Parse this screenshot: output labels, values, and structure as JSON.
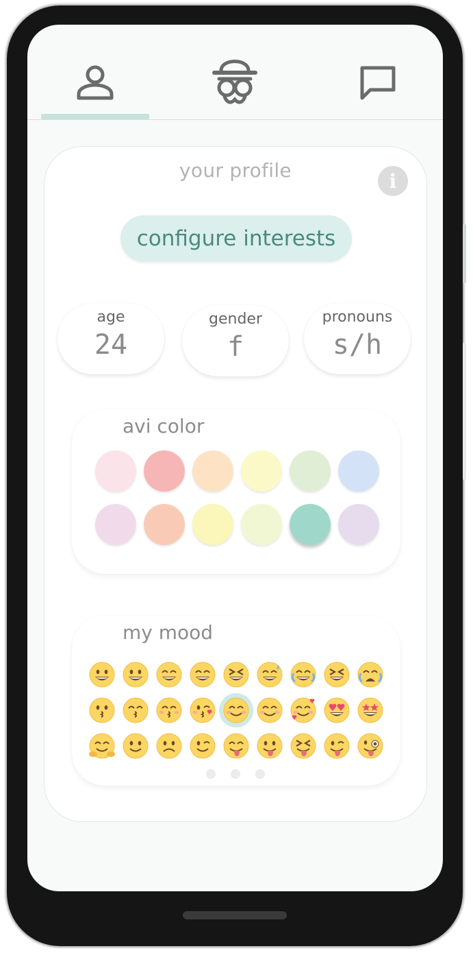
{
  "nav": {
    "tabs": [
      {
        "name": "profile",
        "icon": "person-icon",
        "active": true
      },
      {
        "name": "match",
        "icon": "hat-glasses-icon",
        "active": false
      },
      {
        "name": "chat",
        "icon": "chat-bubble-icon",
        "active": false
      }
    ]
  },
  "profile": {
    "title": "your profile",
    "info_label": "i",
    "interests_label": "configure interests",
    "stats": [
      {
        "label": "age",
        "value": "24"
      },
      {
        "label": "gender",
        "value": "f"
      },
      {
        "label": "pronouns",
        "value": "s/h"
      }
    ]
  },
  "avi": {
    "title": "avi color",
    "colors": [
      "#fbe3ea",
      "#f7b6b6",
      "#fde2c4",
      "#fcf9c8",
      "#e1eed6",
      "#d3e2f6",
      "#f1dbea",
      "#f9cbb6",
      "#fbf6b9",
      "#f2f7d3",
      "#9fd8cb",
      "#e6dced"
    ],
    "selected_index": 10
  },
  "mood": {
    "title": "my mood",
    "selected_index": 13,
    "emojis": [
      "grinning-face-icon",
      "grinning-big-eyes-icon",
      "grinning-smiling-eyes-icon",
      "beaming-face-icon",
      "squinting-laugh-icon",
      "sweat-smile-icon",
      "tears-of-joy-icon",
      "rolling-laughing-icon",
      "loudly-crying-icon",
      "kissing-face-icon",
      "kissing-smiling-eyes-icon",
      "kissing-closed-eyes-icon",
      "face-blowing-kiss-icon",
      "smiling-blush-icon",
      "smiling-eyes-icon",
      "smiling-hearts-icon",
      "heart-eyes-icon",
      "star-struck-icon",
      "hugging-face-icon",
      "slight-smile-icon",
      "upside-down-face-icon",
      "winking-face-icon",
      "yum-face-icon",
      "tongue-face-icon",
      "squinting-tongue-icon",
      "winking-tongue-icon",
      "zany-face-icon"
    ],
    "page_count": 3
  }
}
